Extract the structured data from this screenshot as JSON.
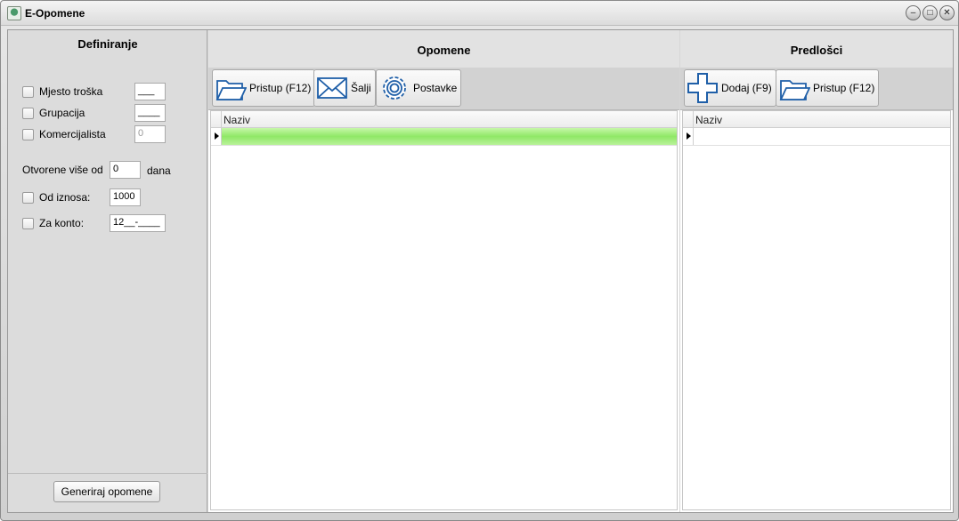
{
  "window": {
    "title": "E-Opomene"
  },
  "definiranje": {
    "title": "Definiranje",
    "options": [
      {
        "label": "Mjesto troška",
        "value": "___",
        "checked": false
      },
      {
        "label": "Grupacija",
        "value": "____",
        "checked": false
      },
      {
        "label": "Komercijalista",
        "value": "0",
        "checked": false,
        "disabled": true
      }
    ],
    "otvorene_label": "Otvorene više od",
    "otvorene_value": "0",
    "otvorene_unit": "dana",
    "od_iznosa_label": "Od iznosa:",
    "od_iznosa_value": "1000",
    "za_konto_label": "Za konto:",
    "za_konto_value": "12__-____",
    "generate_label": "Generiraj opomene"
  },
  "opomene": {
    "title": "Opomene",
    "toolbar": [
      {
        "label": "Pristup (F12)",
        "icon": "folder-icon"
      },
      {
        "label": "Šalji",
        "icon": "envelope-icon"
      },
      {
        "label": "Postavke",
        "icon": "gear-icon"
      }
    ],
    "column": "Naziv"
  },
  "predlosci": {
    "title": "Predlošci",
    "toolbar": [
      {
        "label": "Dodaj (F9)",
        "icon": "plus-icon"
      },
      {
        "label": "Pristup (F12)",
        "icon": "folder-icon"
      }
    ],
    "column": "Naziv"
  },
  "colors": {
    "accent": "#1f5fa8",
    "selected_row": "#8fe866"
  }
}
